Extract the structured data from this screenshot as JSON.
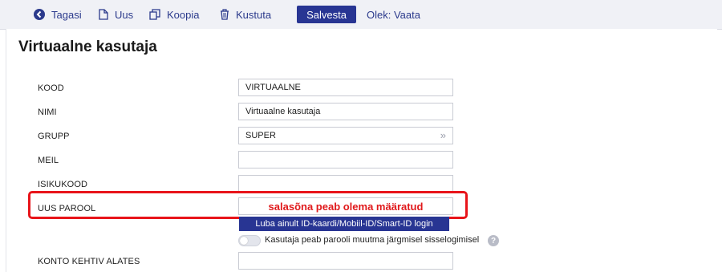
{
  "toolbar": {
    "back_label": "Tagasi",
    "new_label": "Uus",
    "copy_label": "Koopia",
    "delete_label": "Kustuta",
    "save_label": "Salvesta",
    "state_label": "Olek: Vaata",
    "accent_color": "#283593"
  },
  "page": {
    "title": "Virtuaalne kasutaja"
  },
  "form": {
    "kood": {
      "label": "KOOD",
      "value": "VIRTUAALNE"
    },
    "nimi": {
      "label": "NIMI",
      "value": "Virtuaalne kasutaja"
    },
    "grupp": {
      "label": "GRUPP",
      "value": "SUPER",
      "icon": "double-chevron-right-icon"
    },
    "meil": {
      "label": "MEIL",
      "value": ""
    },
    "isikukood": {
      "label": "ISIKUKOOD",
      "value": ""
    },
    "uus_parool": {
      "label": "UUS PAROOL",
      "error": "salasõna peab olema määratud",
      "error_color": "#e0191b"
    },
    "id_login_button": "Luba ainult ID-kaardi/Mobiil-ID/Smart-ID login",
    "password_change_toggle": {
      "label": "Kasutaja peab parooli muutma järgmisel sisselogimisel",
      "on": false,
      "help": "?"
    },
    "konto_kehtiv_alates": {
      "label": "KONTO KEHTIV ALATES",
      "value": ""
    }
  }
}
